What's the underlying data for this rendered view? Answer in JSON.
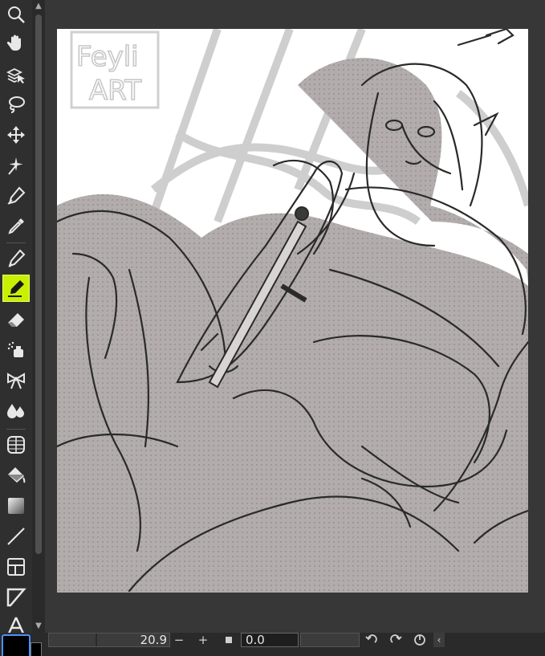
{
  "toolbar": {
    "tools": [
      {
        "name": "zoom-tool",
        "icon": "magnifier-icon"
      },
      {
        "name": "move-tool",
        "icon": "hand-icon"
      },
      {
        "name": "operation-tool",
        "icon": "layer-arrow-icon"
      },
      {
        "name": "lasso-tool",
        "icon": "lasso-icon"
      },
      {
        "name": "move-layer-tool",
        "icon": "move-arrows-icon"
      },
      {
        "name": "auto-select-tool",
        "icon": "magic-wand-icon"
      },
      {
        "name": "pen-tool",
        "icon": "pen-nib-icon"
      },
      {
        "name": "eyedropper-tool",
        "icon": "eyedropper-icon"
      },
      {
        "name": "pen-tool-2",
        "icon": "pen-icon"
      },
      {
        "name": "marker-tool",
        "icon": "marker-icon",
        "active": true
      },
      {
        "name": "eraser-tool",
        "icon": "eraser-icon"
      },
      {
        "name": "airbrush-tool",
        "icon": "spray-icon"
      },
      {
        "name": "decoration-tool",
        "icon": "ribbon-icon"
      },
      {
        "name": "blend-tool",
        "icon": "drops-icon"
      },
      {
        "name": "frame-tool",
        "icon": "grid-globe-icon"
      },
      {
        "name": "fill-tool",
        "icon": "bucket-icon"
      },
      {
        "name": "gradient-tool",
        "icon": "gradient-icon"
      },
      {
        "name": "figure-tool",
        "icon": "line-icon"
      },
      {
        "name": "frame-border-tool",
        "icon": "panel-icon"
      },
      {
        "name": "ruler-tool",
        "icon": "ruler-icon"
      },
      {
        "name": "text-tool",
        "icon": "text-a-icon"
      }
    ]
  },
  "statusbar": {
    "zoom_value": "20.9",
    "zoom_out_label": "−",
    "zoom_in_label": "+",
    "angle_value": "0.0"
  },
  "colors": {
    "active_tool_bg": "#c8f000",
    "swatch_border": "#4a90ff",
    "main_color": "#000000"
  },
  "artwork": {
    "watermark_line1": "Feyli",
    "watermark_line2": "ART"
  }
}
